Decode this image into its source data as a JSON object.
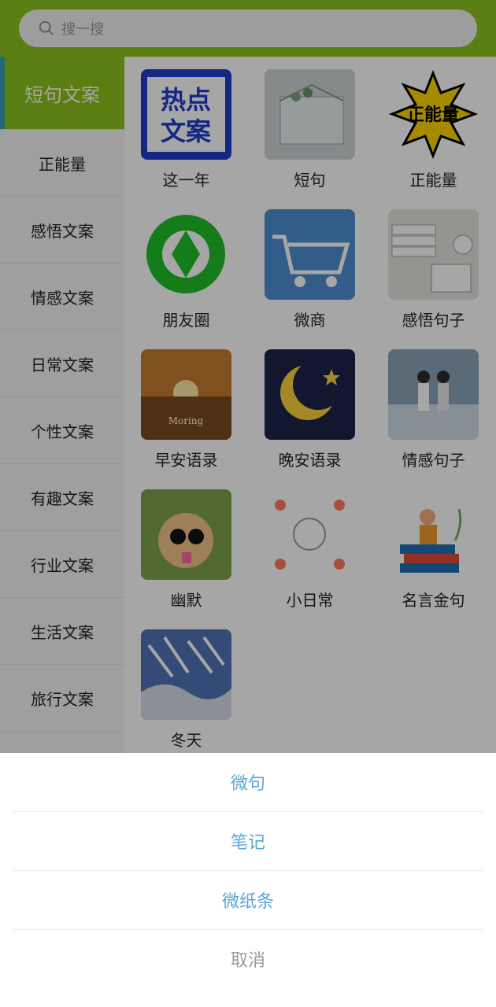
{
  "search": {
    "placeholder": "搜一搜"
  },
  "sidebar": {
    "items": [
      {
        "label": "短句文案",
        "active": true
      },
      {
        "label": "正能量"
      },
      {
        "label": "感悟文案"
      },
      {
        "label": "情感文案"
      },
      {
        "label": "日常文案"
      },
      {
        "label": "个性文案"
      },
      {
        "label": "有趣文案"
      },
      {
        "label": "行业文案"
      },
      {
        "label": "生活文案"
      },
      {
        "label": "旅行文案"
      }
    ]
  },
  "grid": {
    "tiles": [
      {
        "label": "这一年",
        "thumb_text": [
          "热点",
          "文案"
        ]
      },
      {
        "label": "短句"
      },
      {
        "label": "正能量",
        "thumb_text": [
          "正能量"
        ]
      },
      {
        "label": "朋友圈"
      },
      {
        "label": "微商"
      },
      {
        "label": "感悟句子"
      },
      {
        "label": "早安语录",
        "thumb_text": [
          "Moring"
        ]
      },
      {
        "label": "晚安语录"
      },
      {
        "label": "情感句子"
      },
      {
        "label": "幽默"
      },
      {
        "label": "小日常"
      },
      {
        "label": "名言金句"
      },
      {
        "label": "冬天"
      }
    ]
  },
  "sheet": {
    "options": [
      {
        "label": "微句"
      },
      {
        "label": "笔记"
      },
      {
        "label": "微纸条"
      },
      {
        "label": "取消"
      }
    ]
  },
  "colors": {
    "accent": "#8bc21b",
    "sheet_text": "#5aa7d5"
  }
}
